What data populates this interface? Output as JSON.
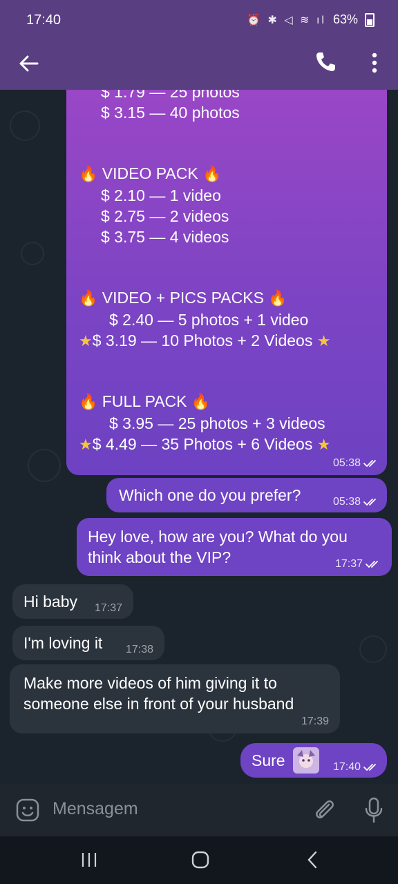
{
  "status": {
    "time": "17:40",
    "battery": "63%"
  },
  "header": {},
  "messages": {
    "pack": {
      "line0": "$ 1.79 — 25 photos",
      "line1": "$ 3.15 — 40 photos",
      "video_title": "VIDEO PACK",
      "video1": "$ 2.10 — 1 video",
      "video2": "$ 2.75 — 2 videos",
      "video3": "$ 3.75 — 4 videos",
      "vp_title": "VIDEO + PICS PACKS",
      "vp1": "$ 2.40 — 5 photos + 1 video",
      "vp2": "$ 3.19 — 10 Photos + 2 Videos",
      "full_title": "FULL PACK",
      "full1": "$ 3.95 — 25 photos + 3 videos",
      "full2": "$ 4.49 — 35 Photos + 6 Videos",
      "time": "05:38"
    },
    "prefer": {
      "text": "Which one do you prefer?",
      "time": "05:38"
    },
    "hey": {
      "line1": "Hey love, how are you? What do you",
      "line2": "think about the VIP?",
      "time": "17:37"
    },
    "hi": {
      "text": "Hi baby",
      "time": "17:37"
    },
    "loving": {
      "text": "I'm loving it",
      "time": "17:38"
    },
    "make": {
      "line1": "Make more videos of him giving it to",
      "line2": "someone else in front of your husband",
      "time": "17:39"
    },
    "sure": {
      "text": "Sure",
      "time": "17:40"
    }
  },
  "composer": {
    "placeholder": "Mensagem"
  },
  "icons": {
    "fire": "fire-emoji",
    "star": "star-emoji",
    "accent": "#6e43c4",
    "incoming_bg": "#2b333d"
  }
}
